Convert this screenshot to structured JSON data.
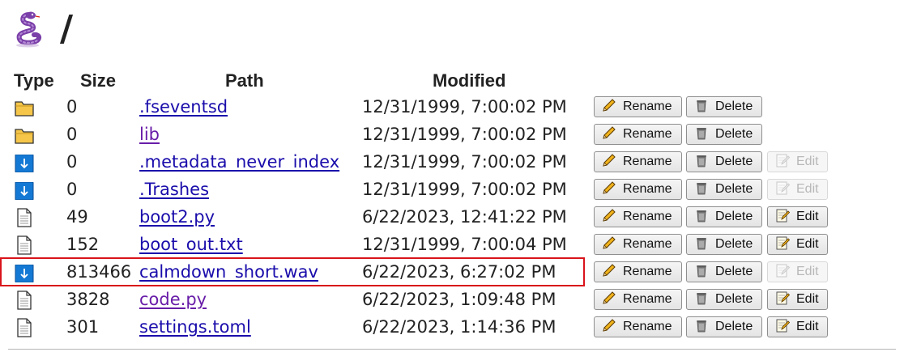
{
  "header": {
    "logo_icon": "snake-logo-icon",
    "title": "/"
  },
  "columns": {
    "type": "Type",
    "size": "Size",
    "path": "Path",
    "modified": "Modified"
  },
  "actions": {
    "rename": "Rename",
    "delete": "Delete",
    "edit": "Edit"
  },
  "files": [
    {
      "type": "folder",
      "icon": "folder-icon",
      "size": "0",
      "path": ".fseventsd",
      "modified": "12/31/1999, 7:00:02 PM",
      "visited": false,
      "edit": "none"
    },
    {
      "type": "folder",
      "icon": "folder-icon",
      "size": "0",
      "path": "lib",
      "modified": "12/31/1999, 7:00:02 PM",
      "visited": true,
      "edit": "none"
    },
    {
      "type": "download",
      "icon": "download-icon",
      "size": "0",
      "path": ".metadata_never_index",
      "modified": "12/31/1999, 7:00:02 PM",
      "visited": false,
      "edit": "disabled"
    },
    {
      "type": "download",
      "icon": "download-icon",
      "size": "0",
      "path": ".Trashes",
      "modified": "12/31/1999, 7:00:02 PM",
      "visited": false,
      "edit": "disabled"
    },
    {
      "type": "file",
      "icon": "file-icon",
      "size": "49",
      "path": "boot2.py",
      "modified": "6/22/2023, 12:41:22 PM",
      "visited": false,
      "edit": "enabled"
    },
    {
      "type": "file",
      "icon": "file-icon",
      "size": "152",
      "path": "boot_out.txt",
      "modified": "12/31/1999, 7:00:04 PM",
      "visited": false,
      "edit": "enabled"
    },
    {
      "type": "download",
      "icon": "download-icon",
      "size": "813466",
      "path": "calmdown_short.wav",
      "modified": "6/22/2023, 6:27:02 PM",
      "visited": false,
      "edit": "disabled",
      "highlighted": true
    },
    {
      "type": "file",
      "icon": "file-icon",
      "size": "3828",
      "path": "code.py",
      "modified": "6/22/2023, 1:09:48 PM",
      "visited": true,
      "edit": "enabled"
    },
    {
      "type": "file",
      "icon": "file-icon",
      "size": "301",
      "path": "settings.toml",
      "modified": "6/22/2023, 1:14:36 PM",
      "visited": false,
      "edit": "enabled"
    }
  ],
  "colors": {
    "link": "#1a0dab",
    "visited_link": "#681da8",
    "highlight_border": "#d9141b",
    "download_icon": "#1479d4",
    "folder_icon": "#f5c64a"
  }
}
